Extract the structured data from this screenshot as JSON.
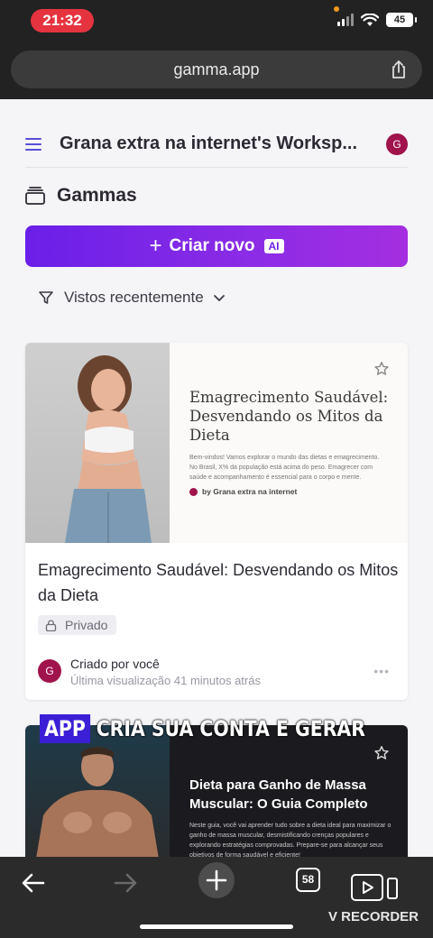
{
  "status_bar": {
    "time": "21:32",
    "battery": "45"
  },
  "browser": {
    "url": "gamma.app",
    "tabs_count": "58"
  },
  "header": {
    "workspace_title": "Grana extra na internet's Worksp...",
    "avatar_initial": "G"
  },
  "section": {
    "title": "Gammas"
  },
  "create_button": {
    "label": "Criar novo",
    "badge": "AI"
  },
  "filter": {
    "label": "Vistos recentemente"
  },
  "cards": [
    {
      "thumb_title": "Emagrecimento Saudável: Desvendando os Mitos da Dieta",
      "thumb_body": "Bem-vindos! Vamos explorar o mundo das dietas e emagrecimento. No Brasil, X% da população está acima do peso. Emagrecer com saúde e acompanhamento é essencial para o corpo e mente.",
      "thumb_author": "by Grana extra na internet",
      "title": "Emagrecimento Saudável: Desvendando os Mitos da Dieta",
      "privacy": "Privado",
      "creator": "Criado por você",
      "last_viewed": "Última visualização 41 minutos atrás",
      "avatar_initial": "G"
    },
    {
      "thumb_title": "Dieta para Ganho de Massa Muscular: O Guia Completo",
      "thumb_body": "Neste guia, você vai aprender tudo sobre a dieta ideal para maximizar o ganho de massa muscular, desmistificando crenças populares e explorando estratégias comprovadas. Prepare-se para alcançar seus objetivos de forma saudável e eficiente!"
    }
  ],
  "caption": {
    "highlight": "APP",
    "rest": "CRIA SUA CONTA E GERAR"
  },
  "watermark": {
    "label": "V RECORDER"
  },
  "colors": {
    "accent": "#6a1fe8",
    "avatar": "#a0134b",
    "status_time": "#e5333f"
  }
}
